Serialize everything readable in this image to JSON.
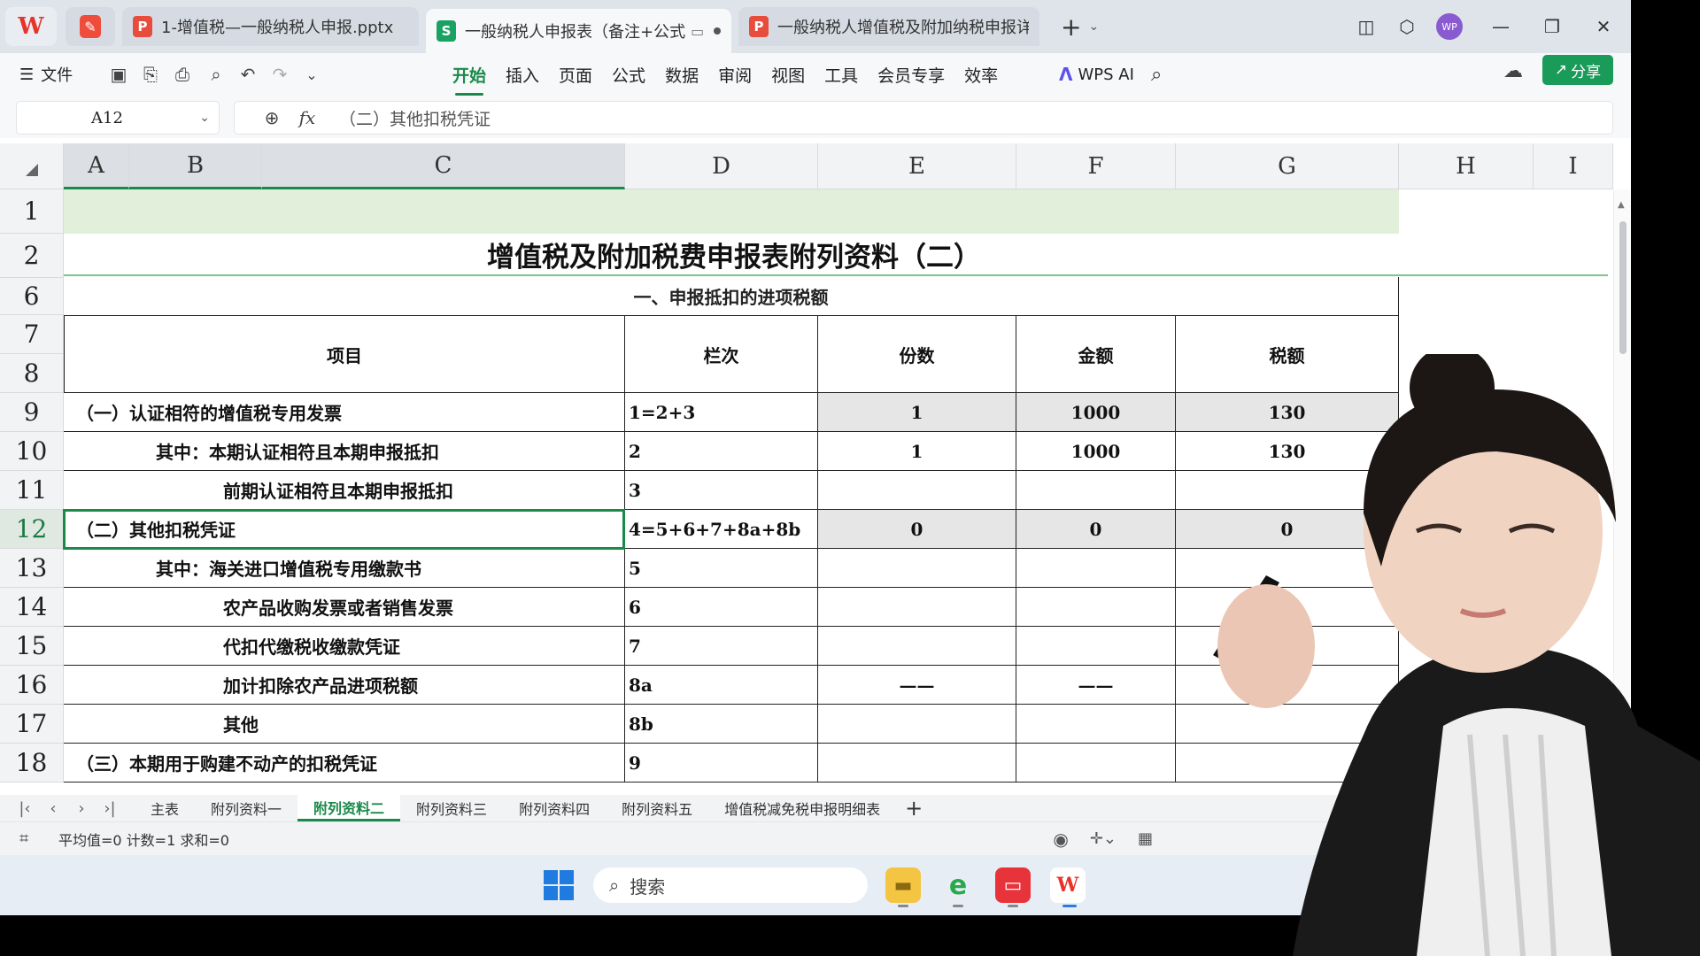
{
  "titlebar": {
    "tabs": [
      {
        "label": "1-增值税—一般纳税人申报.pptx",
        "icon": "P"
      },
      {
        "label": "一般纳税人申报表（备注+公式",
        "icon": "S"
      },
      {
        "label": "一般纳税人增值税及附加纳税申报详解",
        "icon": "P"
      }
    ],
    "avatar": "WP"
  },
  "toolbar": {
    "file_label": "文件",
    "ribbon_tabs": [
      "开始",
      "插入",
      "页面",
      "公式",
      "数据",
      "审阅",
      "视图",
      "工具",
      "会员专享",
      "效率"
    ],
    "active_tab": "开始",
    "wps_ai": "WPS AI",
    "share": "分享"
  },
  "formula_bar": {
    "cell_ref": "A12",
    "value": "（二）其他扣税凭证"
  },
  "columns": [
    "A",
    "B",
    "C",
    "D",
    "E",
    "F",
    "G",
    "H",
    "I"
  ],
  "rows": [
    "1",
    "2",
    "6",
    "7",
    "8",
    "9",
    "10",
    "11",
    "12",
    "13",
    "14",
    "15",
    "16",
    "17",
    "18"
  ],
  "sheet": {
    "title": "增值税及附加税费申报表附列资料（二）",
    "section": "一、申报抵扣的进项税额",
    "headers": {
      "item": "项目",
      "line": "栏次",
      "count": "份数",
      "amount": "金额",
      "tax": "税额"
    },
    "data_rows": [
      {
        "row": "9",
        "item": "（一）认证相符的增值税专用发票",
        "line": "1=2+3",
        "count": "1",
        "amount": "1000",
        "tax": "130"
      },
      {
        "row": "10",
        "item": "其中：本期认证相符且本期申报抵扣",
        "line": "2",
        "count": "1",
        "amount": "1000",
        "tax": "130"
      },
      {
        "row": "11",
        "item": "前期认证相符且本期申报抵扣",
        "line": "3",
        "count": "",
        "amount": "",
        "tax": ""
      },
      {
        "row": "12",
        "item": "（二）其他扣税凭证",
        "line": "4=5+6+7+8a+8b",
        "count": "0",
        "amount": "0",
        "tax": "0"
      },
      {
        "row": "13",
        "item": "其中：海关进口增值税专用缴款书",
        "line": "5",
        "count": "",
        "amount": "",
        "tax": ""
      },
      {
        "row": "14",
        "item": "农产品收购发票或者销售发票",
        "line": "6",
        "count": "",
        "amount": "",
        "tax": ""
      },
      {
        "row": "15",
        "item": "代扣代缴税收缴款凭证",
        "line": "7",
        "count": "",
        "amount": "",
        "tax": ""
      },
      {
        "row": "16",
        "item": "加计扣除农产品进项税额",
        "line": "8a",
        "count": "——",
        "amount": "——",
        "tax": ""
      },
      {
        "row": "17",
        "item": "其他",
        "line": "8b",
        "count": "",
        "amount": "",
        "tax": ""
      },
      {
        "row": "18",
        "item": "（三）本期用于购建不动产的扣税凭证",
        "line": "9",
        "count": "",
        "amount": "",
        "tax": ""
      }
    ]
  },
  "sheet_tabs": [
    "主表",
    "附列资料一",
    "附列资料二",
    "附列资料三",
    "附列资料四",
    "附列资料五",
    "增值税减免税申报明细表"
  ],
  "active_sheet": "附列资料二",
  "status": {
    "text": "平均值=0  计数=1  求和=0"
  },
  "taskbar": {
    "search_placeholder": "搜索"
  },
  "colors": {
    "accent": "#1a8a4a",
    "header_bg": "#f1f3f5",
    "shaded": "#e6e6e6",
    "band": "#e2efdb"
  }
}
